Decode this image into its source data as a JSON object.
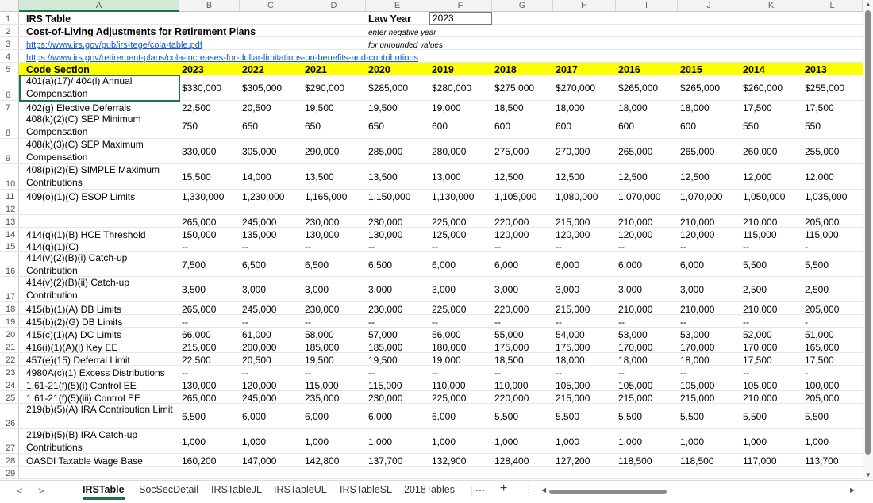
{
  "columns": [
    "A",
    "B",
    "C",
    "D",
    "E",
    "F",
    "G",
    "H",
    "I",
    "J",
    "K",
    "L"
  ],
  "selected_column": "A",
  "header_block": {
    "title": "IRS Table",
    "subtitle": "Cost-of-Living Adjustments for Retirement Plans",
    "link1": "https://www.irs.gov/pub/irs-tege/cola-table.pdf",
    "link2": "https://www.irs.gov/retirement-plans/cola-increases-for-dollar-limitations-on-benefits-and-contributions",
    "law_year_label": "Law Year",
    "law_year_value": "2023",
    "note1": "enter negative year",
    "note2": "for unrounded values"
  },
  "table_header": {
    "code_section": "Code Section",
    "years": [
      "2023",
      "2022",
      "2021",
      "2020",
      "2019",
      "2018",
      "2017",
      "2016",
      "2015",
      "2014",
      "2013"
    ]
  },
  "rows": [
    {
      "n": "6",
      "label": "401(a)(17)/ 404(l) Annual Compensation",
      "vals": [
        "$330,000",
        "$305,000",
        "$290,000",
        "$285,000",
        "$280,000",
        "$275,000",
        "$270,000",
        "$265,000",
        "$265,000",
        "$260,000",
        "$255,000"
      ]
    },
    {
      "n": "7",
      "label": "402(g) Elective Deferrals",
      "vals": [
        "22,500",
        "20,500",
        "19,500",
        "19,500",
        "19,000",
        "18,500",
        "18,000",
        "18,000",
        "18,000",
        "17,500",
        "17,500"
      ]
    },
    {
      "n": "8",
      "label": "408(k)(2)(C) SEP Minimum Compensation",
      "vals": [
        "750",
        "650",
        "650",
        "650",
        "600",
        "600",
        "600",
        "600",
        "600",
        "550",
        "550"
      ]
    },
    {
      "n": "9",
      "label": "408(k)(3)(C) SEP Maximum Compensation",
      "vals": [
        "330,000",
        "305,000",
        "290,000",
        "285,000",
        "280,000",
        "275,000",
        "270,000",
        "265,000",
        "265,000",
        "260,000",
        "255,000"
      ]
    },
    {
      "n": "10",
      "label": "408(p)(2)(E) SIMPLE Maximum Contributions",
      "vals": [
        "15,500",
        "14,000",
        "13,500",
        "13,500",
        "13,000",
        "12,500",
        "12,500",
        "12,500",
        "12,500",
        "12,000",
        "12,000"
      ]
    },
    {
      "n": "11",
      "label": "409(o)(1)(C) ESOP Limits",
      "vals": [
        "1,330,000",
        "1,230,000",
        "1,165,000",
        "1,150,000",
        "1,130,000",
        "1,105,000",
        "1,080,000",
        "1,070,000",
        "1,070,000",
        "1,050,000",
        "1,035,000"
      ]
    },
    {
      "n": "12",
      "label": "",
      "vals": [
        "",
        "",
        "",
        "",
        "",
        "",
        "",
        "",
        "",
        "",
        ""
      ]
    },
    {
      "n": "13",
      "label": "",
      "vals": [
        "265,000",
        "245,000",
        "230,000",
        "230,000",
        "225,000",
        "220,000",
        "215,000",
        "210,000",
        "210,000",
        "210,000",
        "205,000"
      ]
    },
    {
      "n": "14",
      "label": "414(q)(1)(B) HCE Threshold",
      "vals": [
        "150,000",
        "135,000",
        "130,000",
        "130,000",
        "125,000",
        "120,000",
        "120,000",
        "120,000",
        "120,000",
        "115,000",
        "115,000"
      ]
    },
    {
      "n": "15",
      "label": "414(q)(1)(C)",
      "vals": [
        "--",
        "--",
        "--",
        "--",
        "--",
        "--",
        "--",
        "--",
        "--",
        "--",
        "-"
      ]
    },
    {
      "n": "16",
      "label": "414(v)(2)(B)(i) Catch-up Contribution",
      "vals": [
        "7,500",
        "6,500",
        "6,500",
        "6,500",
        "6,000",
        "6,000",
        "6,000",
        "6,000",
        "6,000",
        "5,500",
        "5,500"
      ]
    },
    {
      "n": "17",
      "label": "414(v)(2)(B)(ii) Catch-up Contribution",
      "vals": [
        "3,500",
        "3,000",
        "3,000",
        "3,000",
        "3,000",
        "3,000",
        "3,000",
        "3,000",
        "3,000",
        "2,500",
        "2,500"
      ]
    },
    {
      "n": "18",
      "label": "415(b)(1)(A) DB Limits",
      "vals": [
        "265,000",
        "245,000",
        "230,000",
        "230,000",
        "225,000",
        "220,000",
        "215,000",
        "210,000",
        "210,000",
        "210,000",
        "205,000"
      ]
    },
    {
      "n": "19",
      "label": "415(b)(2)(G) DB Limits",
      "vals": [
        "--",
        "--",
        "--",
        "--",
        "--",
        "--",
        "--",
        "--",
        "--",
        "--",
        "-"
      ]
    },
    {
      "n": "20",
      "label": "415(c)(1)(A) DC Limits",
      "vals": [
        "66,000",
        "61,000",
        "58,000",
        "57,000",
        "56,000",
        "55,000",
        "54,000",
        "53,000",
        "53,000",
        "52,000",
        "51,000"
      ]
    },
    {
      "n": "21",
      "label": "416(i)(1)(A)(i) Key EE",
      "vals": [
        "215,000",
        "200,000",
        "185,000",
        "185,000",
        "180,000",
        "175,000",
        "175,000",
        "170,000",
        "170,000",
        "170,000",
        "165,000"
      ]
    },
    {
      "n": "22",
      "label": "457(e)(15) Deferral Limit",
      "vals": [
        "22,500",
        "20,500",
        "19,500",
        "19,500",
        "19,000",
        "18,500",
        "18,000",
        "18,000",
        "18,000",
        "17,500",
        "17,500"
      ]
    },
    {
      "n": "23",
      "label": "4980A(c)(1) Excess Distributions",
      "vals": [
        "--",
        "--",
        "--",
        "--",
        "--",
        "--",
        "--",
        "--",
        "--",
        "--",
        "-"
      ]
    },
    {
      "n": "24",
      "label": "1.61-21(f)(5)(i) Control EE",
      "vals": [
        "130,000",
        "120,000",
        "115,000",
        "115,000",
        "110,000",
        "110,000",
        "105,000",
        "105,000",
        "105,000",
        "105,000",
        "100,000"
      ]
    },
    {
      "n": "25",
      "label": "1.61-21(f)(5)(iii) Control EE",
      "vals": [
        "265,000",
        "245,000",
        "235,000",
        "230,000",
        "225,000",
        "220,000",
        "215,000",
        "215,000",
        "215,000",
        "210,000",
        "205,000"
      ]
    },
    {
      "n": "26",
      "label": "219(b)(5)(A) IRA Contribution Limit",
      "vals": [
        "6,500",
        "6,000",
        "6,000",
        "6,000",
        "6,000",
        "5,500",
        "5,500",
        "5,500",
        "5,500",
        "5,500",
        "5,500"
      ]
    },
    {
      "n": "27",
      "label": "219(b)(5)(B) IRA Catch-up Contributions",
      "vals": [
        "1,000",
        "1,000",
        "1,000",
        "1,000",
        "1,000",
        "1,000",
        "1,000",
        "1,000",
        "1,000",
        "1,000",
        "1,000"
      ]
    },
    {
      "n": "28",
      "label": "OASDI Taxable Wage Base",
      "vals": [
        "160,200",
        "147,000",
        "142,800",
        "137,700",
        "132,900",
        "128,400",
        "127,200",
        "118,500",
        "118,500",
        "117,000",
        "113,700"
      ]
    },
    {
      "n": "29",
      "label": "",
      "vals": [
        "",
        "",
        "",
        "",
        "",
        "",
        "",
        "",
        "",
        "",
        ""
      ]
    }
  ],
  "sheet_tabs": [
    "IRSTable",
    "SocSecDetail",
    "IRSTableJL",
    "IRSTableUL",
    "IRSTableSL",
    "2018Tables"
  ],
  "active_tab": "IRSTable",
  "tab_more": "⋯",
  "add_sheet": "+",
  "more_options": "⋮",
  "nav_prev": "<",
  "nav_next": ">"
}
